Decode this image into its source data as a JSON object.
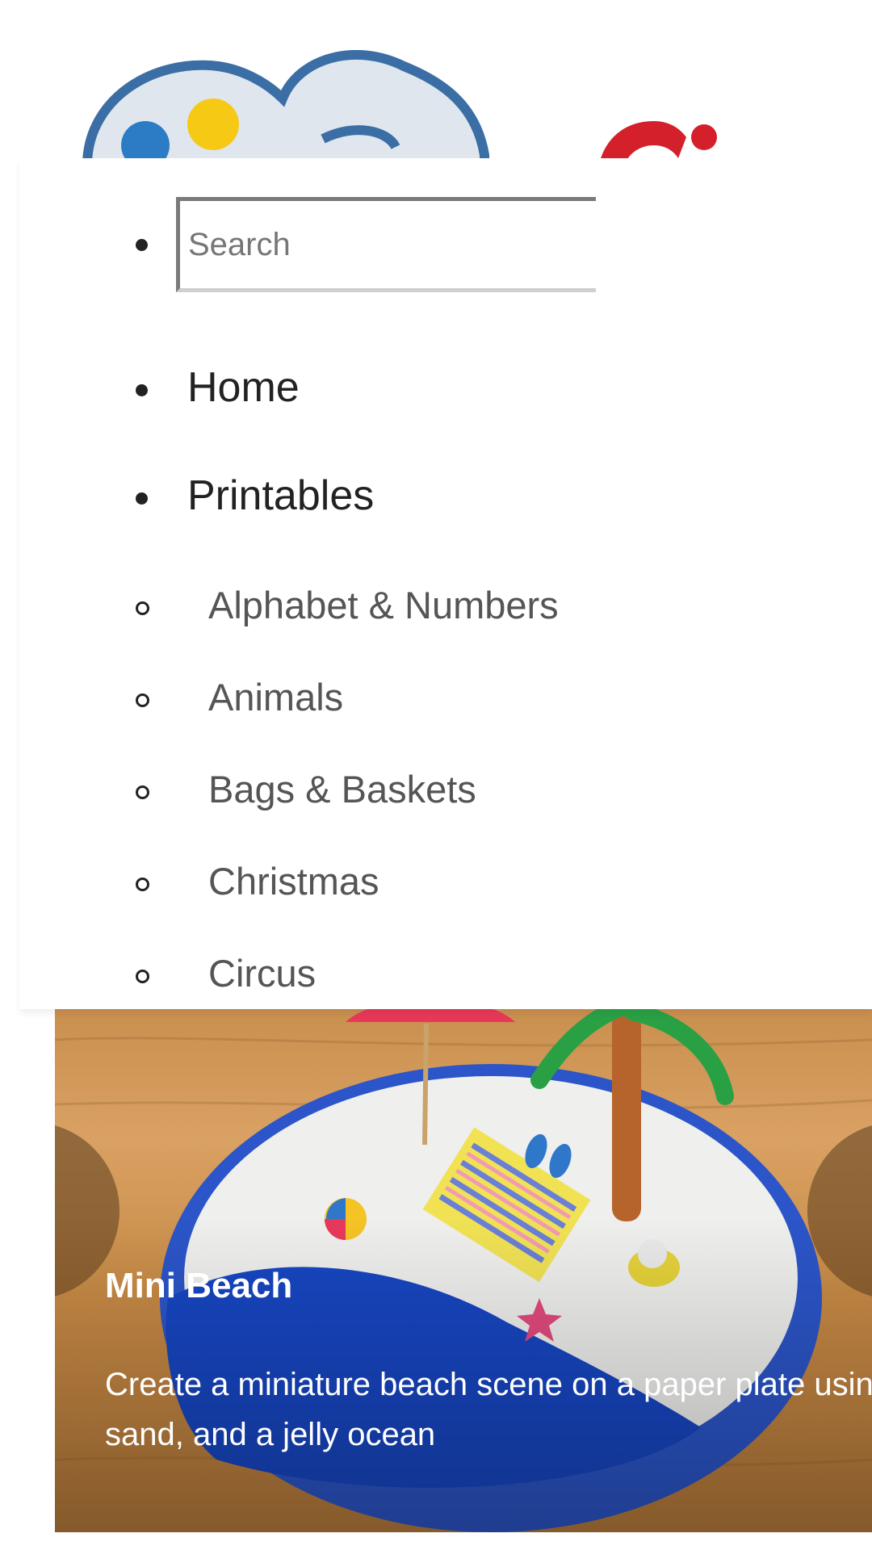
{
  "header": {
    "logo_alt": "site-logo"
  },
  "menu": {
    "search": {
      "placeholder": "Search",
      "value": ""
    },
    "items": [
      {
        "label": "Home"
      },
      {
        "label": "Printables"
      }
    ],
    "subitems": [
      {
        "label": "Alphabet & Numbers"
      },
      {
        "label": "Animals"
      },
      {
        "label": "Bags & Baskets"
      },
      {
        "label": "Christmas"
      },
      {
        "label": "Circus"
      }
    ]
  },
  "slide": {
    "title": "Mini Beach",
    "description": "Create a miniature beach scene on a paper plate using clay, sand, and a jelly ocean"
  },
  "colors": {
    "logo_blue": "#3a6ea5",
    "logo_yellow": "#f6c915",
    "logo_red": "#d4202a",
    "ocean_blue": "#1746c2",
    "wood": "#c98f4e"
  },
  "icons": [
    "logo-cloud-icon",
    "logo-letter-icon"
  ]
}
